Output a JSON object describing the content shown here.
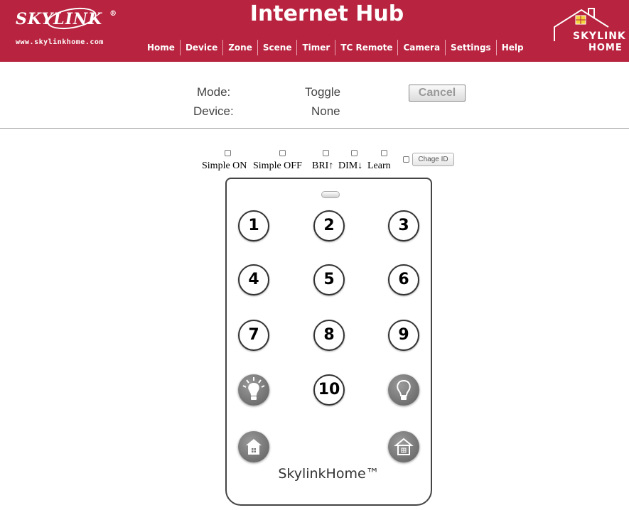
{
  "header": {
    "brand": "SKYLINK",
    "registered": "®",
    "url": "www.skylinkhome.com",
    "title": "Internet Hub",
    "right_logo_line1": "SKYLINK",
    "right_logo_line2": "HOME",
    "brand_color": "#b8233f"
  },
  "nav": {
    "items": [
      "Home",
      "Device",
      "Zone",
      "Scene",
      "Timer",
      "TC Remote",
      "Camera",
      "Settings",
      "Help"
    ]
  },
  "info": {
    "mode_label": "Mode:",
    "mode_value": "Toggle",
    "device_label": "Device:",
    "device_value": "None",
    "cancel_label": "Cancel"
  },
  "options": {
    "labels": [
      "Simple ON",
      "Simple OFF",
      "BRI↑",
      "DIM↓",
      "Learn"
    ],
    "chage_id_label": "Chage ID"
  },
  "remote": {
    "buttons": [
      "1",
      "2",
      "3",
      "4",
      "5",
      "6",
      "7",
      "8",
      "9",
      "10"
    ],
    "icons": [
      "bulb-on-icon",
      "bulb-off-icon",
      "home-icon",
      "home-icon"
    ],
    "brand": "SkylinkHome™"
  }
}
